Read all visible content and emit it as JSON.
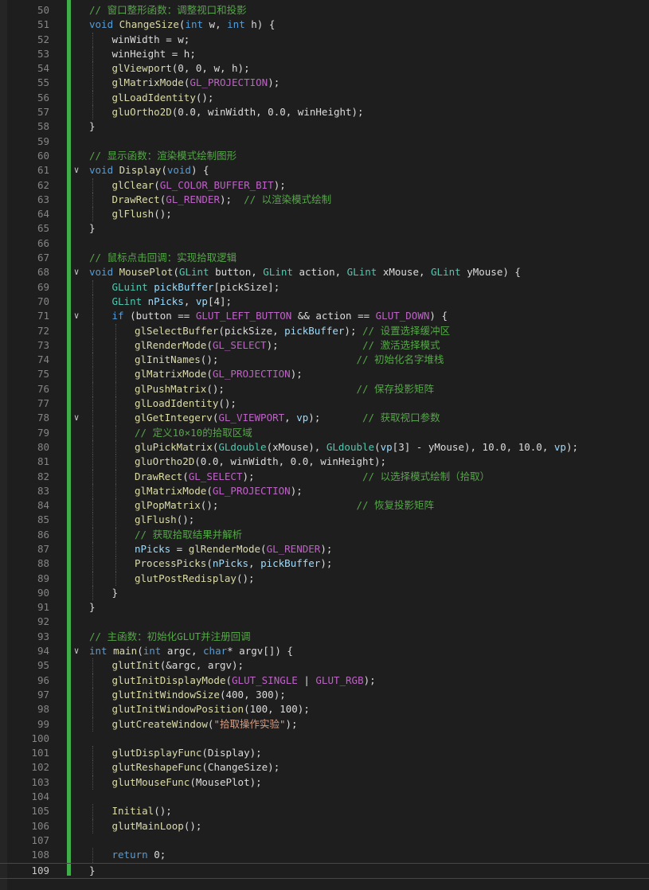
{
  "editor": {
    "active_line": 109,
    "lines": [
      {
        "num": "50",
        "fold": "",
        "indent": 1,
        "tokens": [
          {
            "t": "// 窗口整形函数：调整视口和投影",
            "c": "c"
          }
        ]
      },
      {
        "num": "51",
        "fold": "",
        "indent": 1,
        "tokens": [
          {
            "t": "void ",
            "c": "k"
          },
          {
            "t": "ChangeSize",
            "c": "f"
          },
          {
            "t": "(",
            "c": "p"
          },
          {
            "t": "int ",
            "c": "k"
          },
          {
            "t": "w",
            "c": "p"
          },
          {
            "t": ", ",
            "c": "p"
          },
          {
            "t": "int ",
            "c": "k"
          },
          {
            "t": "h",
            "c": "p"
          },
          {
            "t": ") {",
            "c": "p"
          }
        ]
      },
      {
        "num": "52",
        "fold": "",
        "indent": 2,
        "tokens": [
          {
            "t": "winWidth = w;",
            "c": "p"
          }
        ]
      },
      {
        "num": "53",
        "fold": "",
        "indent": 2,
        "tokens": [
          {
            "t": "winHeight = h;",
            "c": "p"
          }
        ]
      },
      {
        "num": "54",
        "fold": "",
        "indent": 2,
        "tokens": [
          {
            "t": "glViewport",
            "c": "f"
          },
          {
            "t": "(0, 0, w, h);",
            "c": "p"
          }
        ]
      },
      {
        "num": "55",
        "fold": "",
        "indent": 2,
        "tokens": [
          {
            "t": "glMatrixMode",
            "c": "f"
          },
          {
            "t": "(",
            "c": "p"
          },
          {
            "t": "GL_PROJECTION",
            "c": "m"
          },
          {
            "t": ");",
            "c": "p"
          }
        ]
      },
      {
        "num": "56",
        "fold": "",
        "indent": 2,
        "tokens": [
          {
            "t": "glLoadIdentity",
            "c": "f"
          },
          {
            "t": "();",
            "c": "p"
          }
        ]
      },
      {
        "num": "57",
        "fold": "",
        "indent": 2,
        "tokens": [
          {
            "t": "gluOrtho2D",
            "c": "f"
          },
          {
            "t": "(0.0, winWidth, 0.0, winHeight);",
            "c": "p"
          }
        ]
      },
      {
        "num": "58",
        "fold": "",
        "indent": 1,
        "tokens": [
          {
            "t": "}",
            "c": "p"
          }
        ]
      },
      {
        "num": "59",
        "fold": "",
        "indent": 0,
        "tokens": []
      },
      {
        "num": "60",
        "fold": "",
        "indent": 1,
        "tokens": [
          {
            "t": "// 显示函数：渲染模式绘制图形",
            "c": "c"
          }
        ]
      },
      {
        "num": "61",
        "fold": "v",
        "indent": 1,
        "tokens": [
          {
            "t": "void ",
            "c": "k"
          },
          {
            "t": "Display",
            "c": "f"
          },
          {
            "t": "(",
            "c": "p"
          },
          {
            "t": "void",
            "c": "k"
          },
          {
            "t": ") {",
            "c": "p"
          }
        ]
      },
      {
        "num": "62",
        "fold": "",
        "indent": 2,
        "tokens": [
          {
            "t": "glClear",
            "c": "f"
          },
          {
            "t": "(",
            "c": "p"
          },
          {
            "t": "GL_COLOR_BUFFER_BIT",
            "c": "m"
          },
          {
            "t": ");",
            "c": "p"
          }
        ]
      },
      {
        "num": "63",
        "fold": "",
        "indent": 2,
        "tokens": [
          {
            "t": "DrawRect",
            "c": "f"
          },
          {
            "t": "(",
            "c": "p"
          },
          {
            "t": "GL_RENDER",
            "c": "m"
          },
          {
            "t": ");  ",
            "c": "p"
          },
          {
            "t": "// 以渲染模式绘制",
            "c": "c"
          }
        ]
      },
      {
        "num": "64",
        "fold": "",
        "indent": 2,
        "tokens": [
          {
            "t": "glFlush",
            "c": "f"
          },
          {
            "t": "();",
            "c": "p"
          }
        ]
      },
      {
        "num": "65",
        "fold": "",
        "indent": 1,
        "tokens": [
          {
            "t": "}",
            "c": "p"
          }
        ]
      },
      {
        "num": "66",
        "fold": "",
        "indent": 0,
        "tokens": []
      },
      {
        "num": "67",
        "fold": "",
        "indent": 1,
        "tokens": [
          {
            "t": "// 鼠标点击回调：实现拾取逻辑",
            "c": "c"
          }
        ]
      },
      {
        "num": "68",
        "fold": "v",
        "indent": 1,
        "tokens": [
          {
            "t": "void ",
            "c": "k"
          },
          {
            "t": "MousePlot",
            "c": "f"
          },
          {
            "t": "(",
            "c": "p"
          },
          {
            "t": "GLint ",
            "c": "t"
          },
          {
            "t": "button, ",
            "c": "p"
          },
          {
            "t": "GLint ",
            "c": "t"
          },
          {
            "t": "action, ",
            "c": "p"
          },
          {
            "t": "GLint ",
            "c": "t"
          },
          {
            "t": "xMouse, ",
            "c": "p"
          },
          {
            "t": "GLint ",
            "c": "t"
          },
          {
            "t": "yMouse) {",
            "c": "p"
          }
        ]
      },
      {
        "num": "69",
        "fold": "",
        "indent": 2,
        "tokens": [
          {
            "t": "GLuint ",
            "c": "t"
          },
          {
            "t": "pickBuffer",
            "c": "v"
          },
          {
            "t": "[pickSize];",
            "c": "p"
          }
        ]
      },
      {
        "num": "70",
        "fold": "",
        "indent": 2,
        "tokens": [
          {
            "t": "GLint ",
            "c": "t"
          },
          {
            "t": "nPicks",
            "c": "v"
          },
          {
            "t": ", ",
            "c": "p"
          },
          {
            "t": "vp",
            "c": "v"
          },
          {
            "t": "[4];",
            "c": "p"
          }
        ]
      },
      {
        "num": "71",
        "fold": "v",
        "indent": 2,
        "tokens": [
          {
            "t": "if ",
            "c": "k"
          },
          {
            "t": "(button == ",
            "c": "p"
          },
          {
            "t": "GLUT_LEFT_BUTTON",
            "c": "m"
          },
          {
            "t": " && action == ",
            "c": "p"
          },
          {
            "t": "GLUT_DOWN",
            "c": "m"
          },
          {
            "t": ") {",
            "c": "p"
          }
        ]
      },
      {
        "num": "72",
        "fold": "",
        "indent": 3,
        "tokens": [
          {
            "t": "glSelectBuffer",
            "c": "f"
          },
          {
            "t": "(pickSize, ",
            "c": "p"
          },
          {
            "t": "pickBuffer",
            "c": "v"
          },
          {
            "t": "); ",
            "c": "p"
          },
          {
            "t": "// 设置选择缓冲区",
            "c": "c"
          }
        ]
      },
      {
        "num": "73",
        "fold": "",
        "indent": 3,
        "tokens": [
          {
            "t": "glRenderMode",
            "c": "f"
          },
          {
            "t": "(",
            "c": "p"
          },
          {
            "t": "GL_SELECT",
            "c": "m"
          },
          {
            "t": ");              ",
            "c": "p"
          },
          {
            "t": "// 激活选择模式",
            "c": "c"
          }
        ]
      },
      {
        "num": "74",
        "fold": "",
        "indent": 3,
        "tokens": [
          {
            "t": "glInitNames",
            "c": "f"
          },
          {
            "t": "();                       ",
            "c": "p"
          },
          {
            "t": "// 初始化名字堆栈",
            "c": "c"
          }
        ]
      },
      {
        "num": "75",
        "fold": "",
        "indent": 3,
        "tokens": [
          {
            "t": "glMatrixMode",
            "c": "f"
          },
          {
            "t": "(",
            "c": "p"
          },
          {
            "t": "GL_PROJECTION",
            "c": "m"
          },
          {
            "t": ");",
            "c": "p"
          }
        ]
      },
      {
        "num": "76",
        "fold": "",
        "indent": 3,
        "tokens": [
          {
            "t": "glPushMatrix",
            "c": "f"
          },
          {
            "t": "();                      ",
            "c": "p"
          },
          {
            "t": "// 保存投影矩阵",
            "c": "c"
          }
        ]
      },
      {
        "num": "77",
        "fold": "",
        "indent": 3,
        "tokens": [
          {
            "t": "glLoadIdentity",
            "c": "f"
          },
          {
            "t": "();",
            "c": "p"
          }
        ]
      },
      {
        "num": "78",
        "fold": "v",
        "indent": 3,
        "tokens": [
          {
            "t": "glGetIntegerv",
            "c": "f"
          },
          {
            "t": "(",
            "c": "p"
          },
          {
            "t": "GL_VIEWPORT",
            "c": "m"
          },
          {
            "t": ", ",
            "c": "p"
          },
          {
            "t": "vp",
            "c": "v"
          },
          {
            "t": ");       ",
            "c": "p"
          },
          {
            "t": "// 获取视口参数",
            "c": "c"
          }
        ]
      },
      {
        "num": "79",
        "fold": "",
        "indent": 3,
        "tokens": [
          {
            "t": "// 定义10×10的拾取区域",
            "c": "c"
          }
        ]
      },
      {
        "num": "80",
        "fold": "",
        "indent": 3,
        "tokens": [
          {
            "t": "gluPickMatrix",
            "c": "f"
          },
          {
            "t": "(",
            "c": "p"
          },
          {
            "t": "GLdouble",
            "c": "t"
          },
          {
            "t": "(xMouse), ",
            "c": "p"
          },
          {
            "t": "GLdouble",
            "c": "t"
          },
          {
            "t": "(",
            "c": "p"
          },
          {
            "t": "vp",
            "c": "v"
          },
          {
            "t": "[3] - yMouse), 10.0, 10.0, ",
            "c": "p"
          },
          {
            "t": "vp",
            "c": "v"
          },
          {
            "t": ");",
            "c": "p"
          }
        ]
      },
      {
        "num": "81",
        "fold": "",
        "indent": 3,
        "tokens": [
          {
            "t": "gluOrtho2D",
            "c": "f"
          },
          {
            "t": "(0.0, winWidth, 0.0, winHeight);",
            "c": "p"
          }
        ]
      },
      {
        "num": "82",
        "fold": "",
        "indent": 3,
        "tokens": [
          {
            "t": "DrawRect",
            "c": "f"
          },
          {
            "t": "(",
            "c": "p"
          },
          {
            "t": "GL_SELECT",
            "c": "m"
          },
          {
            "t": ");                  ",
            "c": "p"
          },
          {
            "t": "// 以选择模式绘制（拾取）",
            "c": "c"
          }
        ]
      },
      {
        "num": "83",
        "fold": "",
        "indent": 3,
        "tokens": [
          {
            "t": "glMatrixMode",
            "c": "f"
          },
          {
            "t": "(",
            "c": "p"
          },
          {
            "t": "GL_PROJECTION",
            "c": "m"
          },
          {
            "t": ");",
            "c": "p"
          }
        ]
      },
      {
        "num": "84",
        "fold": "",
        "indent": 3,
        "tokens": [
          {
            "t": "glPopMatrix",
            "c": "f"
          },
          {
            "t": "();                       ",
            "c": "p"
          },
          {
            "t": "// 恢复投影矩阵",
            "c": "c"
          }
        ]
      },
      {
        "num": "85",
        "fold": "",
        "indent": 3,
        "tokens": [
          {
            "t": "glFlush",
            "c": "f"
          },
          {
            "t": "();",
            "c": "p"
          }
        ]
      },
      {
        "num": "86",
        "fold": "",
        "indent": 3,
        "tokens": [
          {
            "t": "// 获取拾取结果并解析",
            "c": "c"
          }
        ]
      },
      {
        "num": "87",
        "fold": "",
        "indent": 3,
        "tokens": [
          {
            "t": "nPicks",
            "c": "v"
          },
          {
            "t": " = ",
            "c": "p"
          },
          {
            "t": "glRenderMode",
            "c": "f"
          },
          {
            "t": "(",
            "c": "p"
          },
          {
            "t": "GL_RENDER",
            "c": "m"
          },
          {
            "t": ");",
            "c": "p"
          }
        ]
      },
      {
        "num": "88",
        "fold": "",
        "indent": 3,
        "tokens": [
          {
            "t": "ProcessPicks",
            "c": "f"
          },
          {
            "t": "(",
            "c": "p"
          },
          {
            "t": "nPicks",
            "c": "v"
          },
          {
            "t": ", ",
            "c": "p"
          },
          {
            "t": "pickBuffer",
            "c": "v"
          },
          {
            "t": ");",
            "c": "p"
          }
        ]
      },
      {
        "num": "89",
        "fold": "",
        "indent": 3,
        "tokens": [
          {
            "t": "glutPostRedisplay",
            "c": "f"
          },
          {
            "t": "();",
            "c": "p"
          }
        ]
      },
      {
        "num": "90",
        "fold": "",
        "indent": 2,
        "tokens": [
          {
            "t": "}",
            "c": "p"
          }
        ]
      },
      {
        "num": "91",
        "fold": "",
        "indent": 1,
        "tokens": [
          {
            "t": "}",
            "c": "p"
          }
        ]
      },
      {
        "num": "92",
        "fold": "",
        "indent": 0,
        "tokens": []
      },
      {
        "num": "93",
        "fold": "",
        "indent": 1,
        "tokens": [
          {
            "t": "// 主函数：初始化GLUT并注册回调",
            "c": "c"
          }
        ]
      },
      {
        "num": "94",
        "fold": "v",
        "indent": 1,
        "tokens": [
          {
            "t": "int ",
            "c": "k"
          },
          {
            "t": "main",
            "c": "f"
          },
          {
            "t": "(",
            "c": "p"
          },
          {
            "t": "int ",
            "c": "k"
          },
          {
            "t": "argc, ",
            "c": "p"
          },
          {
            "t": "char",
            "c": "k"
          },
          {
            "t": "* argv[]) {",
            "c": "p"
          }
        ]
      },
      {
        "num": "95",
        "fold": "",
        "indent": 2,
        "tokens": [
          {
            "t": "glutInit",
            "c": "f"
          },
          {
            "t": "(&argc, argv);",
            "c": "p"
          }
        ]
      },
      {
        "num": "96",
        "fold": "",
        "indent": 2,
        "tokens": [
          {
            "t": "glutInitDisplayMode",
            "c": "f"
          },
          {
            "t": "(",
            "c": "p"
          },
          {
            "t": "GLUT_SINGLE",
            "c": "m"
          },
          {
            "t": " | ",
            "c": "p"
          },
          {
            "t": "GLUT_RGB",
            "c": "m"
          },
          {
            "t": ");",
            "c": "p"
          }
        ]
      },
      {
        "num": "97",
        "fold": "",
        "indent": 2,
        "tokens": [
          {
            "t": "glutInitWindowSize",
            "c": "f"
          },
          {
            "t": "(400, 300);",
            "c": "p"
          }
        ]
      },
      {
        "num": "98",
        "fold": "",
        "indent": 2,
        "tokens": [
          {
            "t": "glutInitWindowPosition",
            "c": "f"
          },
          {
            "t": "(100, 100);",
            "c": "p"
          }
        ]
      },
      {
        "num": "99",
        "fold": "",
        "indent": 2,
        "tokens": [
          {
            "t": "glutCreateWindow",
            "c": "f"
          },
          {
            "t": "(",
            "c": "p"
          },
          {
            "t": "\"拾取操作实验\"",
            "c": "s"
          },
          {
            "t": ");",
            "c": "p"
          }
        ]
      },
      {
        "num": "100",
        "fold": "",
        "indent": 1,
        "tokens": []
      },
      {
        "num": "101",
        "fold": "",
        "indent": 2,
        "tokens": [
          {
            "t": "glutDisplayFunc",
            "c": "f"
          },
          {
            "t": "(Display);",
            "c": "p"
          }
        ]
      },
      {
        "num": "102",
        "fold": "",
        "indent": 2,
        "tokens": [
          {
            "t": "glutReshapeFunc",
            "c": "f"
          },
          {
            "t": "(ChangeSize);",
            "c": "p"
          }
        ]
      },
      {
        "num": "103",
        "fold": "",
        "indent": 2,
        "tokens": [
          {
            "t": "glutMouseFunc",
            "c": "f"
          },
          {
            "t": "(MousePlot);",
            "c": "p"
          }
        ]
      },
      {
        "num": "104",
        "fold": "",
        "indent": 1,
        "tokens": []
      },
      {
        "num": "105",
        "fold": "",
        "indent": 2,
        "tokens": [
          {
            "t": "Initial",
            "c": "f"
          },
          {
            "t": "();",
            "c": "p"
          }
        ]
      },
      {
        "num": "106",
        "fold": "",
        "indent": 2,
        "tokens": [
          {
            "t": "glutMainLoop",
            "c": "f"
          },
          {
            "t": "();",
            "c": "p"
          }
        ]
      },
      {
        "num": "107",
        "fold": "",
        "indent": 1,
        "tokens": []
      },
      {
        "num": "108",
        "fold": "",
        "indent": 2,
        "tokens": [
          {
            "t": "return ",
            "c": "k"
          },
          {
            "t": "0;",
            "c": "p"
          }
        ]
      },
      {
        "num": "109",
        "fold": "",
        "indent": 1,
        "tokens": [
          {
            "t": "}",
            "c": "p"
          }
        ]
      }
    ]
  }
}
